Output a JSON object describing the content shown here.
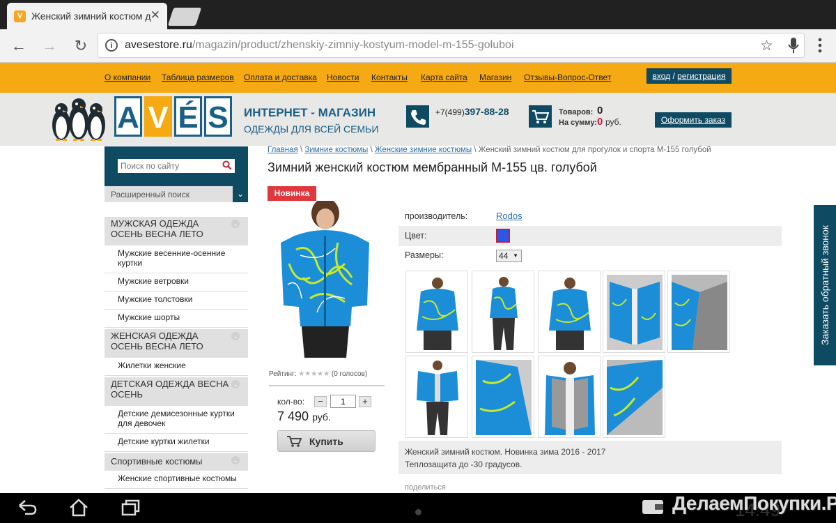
{
  "browser": {
    "tab_title": "Женский зимний костюм д",
    "favicon": "V",
    "url_host": "avesestore.ru",
    "url_path": "/magazin/product/zhenskiy-zimniy-kostyum-model-m-155-goluboi"
  },
  "topnav": {
    "links": [
      "О компании",
      "Таблица размеров",
      "Оплата и доставка",
      "Новости",
      "Контакты",
      "Карта сайта",
      "Магазин",
      "Отзывы-Вопрос-Ответ"
    ],
    "login": "вход",
    "login_sep": " / ",
    "register": "регистрация"
  },
  "header": {
    "logo_letters": [
      "A",
      "V",
      "É",
      "S"
    ],
    "shop_title": "ИНТЕРНЕТ - МАГАЗИН",
    "shop_subtitle": "ОДЕЖДЫ ДЛЯ ВСЕЙ СЕМЬИ",
    "phone_prefix": "+7(499)",
    "phone_number": "397-88-28",
    "cart_items_label": "Товаров:",
    "cart_items_value": "0",
    "cart_sum_label": "На сумму:",
    "cart_sum_value": "0",
    "cart_currency": "руб.",
    "order_button": "Оформить заказ"
  },
  "sidebar": {
    "search_placeholder": "Поиск по сайту",
    "advanced_search": "Расширенный поиск",
    "categories": [
      {
        "label": "МУЖСКАЯ ОДЕЖДА ОСЕНЬ ВЕСНА ЛЕТО",
        "items": [
          "Мужские весенние-осенние куртки",
          "Мужские ветровки",
          "Мужские толстовки",
          "Мужские шорты"
        ]
      },
      {
        "label": "ЖЕНСКАЯ ОДЕЖДА ОСЕНЬ ВЕСНА ЛЕТО",
        "items": [
          "Жилетки женские"
        ]
      },
      {
        "label": "ДЕТСКАЯ ОДЕЖДА ВЕСНА ОСЕНЬ",
        "items": [
          "Детские демисезонные куртки для девочек",
          "Детские куртки жилетки"
        ]
      },
      {
        "label": "Спортивные костюмы",
        "items": [
          "Женские спортивные костюмы"
        ]
      }
    ]
  },
  "breadcrumb": {
    "items": [
      "Главная",
      "Зимние костюмы",
      "Женские зимние костюмы"
    ],
    "current": "Женский зимний костюм для прогулок и спорта М-155 голубой",
    "separator": "\\"
  },
  "product": {
    "title": "Зимний женский костюм мембранный М-155 цв. голубой",
    "badge": "Новинка",
    "rating_label": "Рейтинг:",
    "rating_votes": "(0 голосов)",
    "rating_value": 0,
    "qty_label": "кол-во:",
    "qty_value": "1",
    "price": "7 490",
    "currency": "руб.",
    "buy_button": "Купить",
    "manufacturer_label": "производитель:",
    "manufacturer": "Rodos",
    "color_label": "Цвет:",
    "color_hex": "#2b57e8",
    "sizes_label": "Размеры:",
    "size_selected": "44",
    "description_line1": "Женский зимний костюм. Новинка зима 2016 - 2017",
    "description_line2": "Теплозащита до -30 градусов.",
    "share": "поделиться",
    "thumbnail_count": 9
  },
  "callback_button": "Заказать обратный звонок",
  "system": {
    "clock": "14:49",
    "watermark": "ДелаемПокупки.Ру"
  },
  "colors": {
    "accent_orange": "#f5a912",
    "brand_dark_blue": "#0f4a63",
    "badge_red": "#e0363d",
    "link_blue": "#2a6ea8"
  }
}
